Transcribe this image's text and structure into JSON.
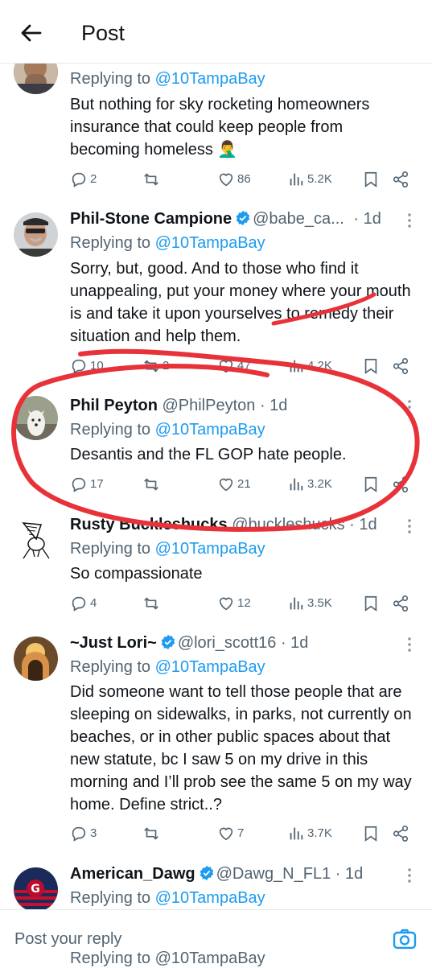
{
  "header": {
    "title": "Post"
  },
  "tweets": [
    {
      "reply_label": "Replying to",
      "mention": "@10TampaBay",
      "text": "But nothing for sky rocketing homeowners insurance that could keep people from becoming homeless 🤦‍♂️",
      "replies": "2",
      "reposts": "",
      "likes": "86",
      "views": "5.2K"
    },
    {
      "name": "Phil-Stone Campione",
      "handle": "@babe_ca...",
      "time": "· 1d",
      "reply_label": "Replying to",
      "mention": "@10TampaBay",
      "text": "Sorry, but, good. And to those who find it unappealing, put your money where your mouth is and take it upon yourselves to remedy their situation and help them.",
      "replies": "10",
      "reposts": "2",
      "likes": "47",
      "views": "4.2K"
    },
    {
      "name": "Phil Peyton",
      "handle": "@PhilPeyton",
      "time": "· 1d",
      "reply_label": "Replying to",
      "mention": "@10TampaBay",
      "text": "Desantis and the FL GOP hate people.",
      "replies": "17",
      "reposts": "",
      "likes": "21",
      "views": "3.2K"
    },
    {
      "name": "Rusty Buckleshucks",
      "handle": "@buckleshucks",
      "time": "· 1d",
      "reply_label": "Replying to",
      "mention": "@10TampaBay",
      "text": "So compassionate",
      "replies": "4",
      "reposts": "",
      "likes": "12",
      "views": "3.5K"
    },
    {
      "name": "~Just Lori~",
      "handle": "@lori_scott16",
      "time": "· 1d",
      "reply_label": "Replying to",
      "mention": "@10TampaBay",
      "text": "Did someone want to tell those people that are sleeping on sidewalks, in parks, not currently on beaches, or in other public spaces about that new statute, bc I saw 5 on my drive in this morning and I’ll prob see the same 5 on my way home. Define strict..?",
      "replies": "3",
      "reposts": "",
      "likes": "7",
      "views": "3.7K"
    },
    {
      "name": "American_Dawg",
      "handle": "@Dawg_N_FL1",
      "time": "· 1d",
      "reply_label": "Replying to",
      "mention": "@10TampaBay"
    }
  ],
  "reply_bar": {
    "placeholder": "Post your reply"
  },
  "peek": "Replying to @10TampaBay",
  "colors": {
    "accent": "#1d9bf0",
    "muted": "#536471",
    "annotation": "#e8323a"
  }
}
